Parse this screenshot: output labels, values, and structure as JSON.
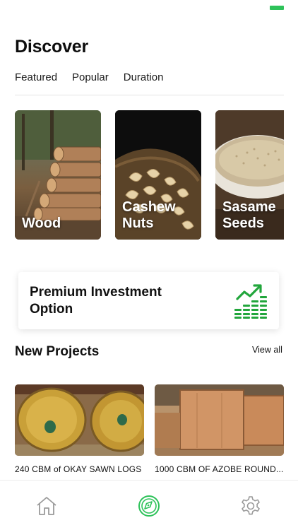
{
  "screen": {
    "title": "Discover"
  },
  "filters": [
    "Featured",
    "Popular",
    "Duration"
  ],
  "categories": [
    {
      "label": "Wood"
    },
    {
      "label": "Cashew\nNuts"
    },
    {
      "label": "Sasame\nSeeds"
    }
  ],
  "premium": {
    "label": "Premium Investment\nOption",
    "icon": "growth-chart-icon",
    "accent": "#22a63c"
  },
  "new_projects": {
    "title": "New Projects",
    "view_all": "View all",
    "items": [
      {
        "caption": "240 CBM of OKAY SAWN LOGS"
      },
      {
        "caption": "1000 CBM OF AZOBE ROUND..."
      }
    ]
  },
  "tabbar": {
    "items": [
      {
        "icon": "home-icon"
      },
      {
        "icon": "compass-icon",
        "active": true
      },
      {
        "icon": "gear-icon"
      }
    ],
    "active_color": "#2ec25a"
  }
}
